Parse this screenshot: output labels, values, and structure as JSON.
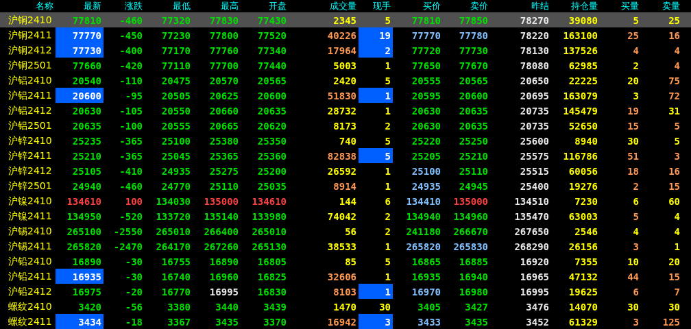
{
  "columns": [
    "名称",
    "最新",
    "涨跌",
    "最低",
    "最高",
    "开盘",
    "成交量",
    "现手",
    "买价",
    "卖价",
    "昨结",
    "持仓量",
    "买量",
    "卖量"
  ],
  "rows": [
    {
      "name": "沪铜2410",
      "selected": true,
      "cells": [
        {
          "text": "77810",
          "color": "#00e000",
          "highlighted": false
        },
        {
          "text": "-460",
          "color": "#00e000",
          "highlighted": false
        },
        {
          "text": "77320",
          "color": "#00e000",
          "highlighted": false
        },
        {
          "text": "77830",
          "color": "#00e000",
          "highlighted": false
        },
        {
          "text": "77430",
          "color": "#00e000",
          "highlighted": false
        },
        {
          "text": "2345",
          "color": "#ffff00",
          "highlighted": false
        },
        {
          "text": "5",
          "color": "#ffff00",
          "highlighted": false
        },
        {
          "text": "77810",
          "color": "#00e000",
          "highlighted": false
        },
        {
          "text": "77850",
          "color": "#00e000",
          "highlighted": false
        },
        {
          "text": "78270",
          "color": "#e8e8e8",
          "highlighted": false
        },
        {
          "text": "39080",
          "color": "#ffff00",
          "highlighted": false
        },
        {
          "text": "5",
          "color": "#ffff00",
          "highlighted": false
        },
        {
          "text": "25",
          "color": "#ffff00",
          "highlighted": false
        }
      ]
    },
    {
      "name": "沪铜2411",
      "selected": false,
      "cells": [
        {
          "text": "77770",
          "color": "#ffffff",
          "highlighted": true
        },
        {
          "text": "-450",
          "color": "#00e000",
          "highlighted": false
        },
        {
          "text": "77230",
          "color": "#00e000",
          "highlighted": false
        },
        {
          "text": "77800",
          "color": "#00e000",
          "highlighted": false
        },
        {
          "text": "77520",
          "color": "#00e000",
          "highlighted": false
        },
        {
          "text": "40226",
          "color": "#ff9850",
          "highlighted": false
        },
        {
          "text": "19",
          "color": "#ffffff",
          "highlighted": true
        },
        {
          "text": "77770",
          "color": "#80c0ff",
          "highlighted": false
        },
        {
          "text": "77780",
          "color": "#80c0ff",
          "highlighted": false
        },
        {
          "text": "78220",
          "color": "#e8e8e8",
          "highlighted": false
        },
        {
          "text": "163100",
          "color": "#ffff00",
          "highlighted": false
        },
        {
          "text": "25",
          "color": "#ff9850",
          "highlighted": false
        },
        {
          "text": "16",
          "color": "#ff9850",
          "highlighted": false
        }
      ]
    },
    {
      "name": "沪铜2412",
      "selected": false,
      "cells": [
        {
          "text": "77730",
          "color": "#ffffff",
          "highlighted": true
        },
        {
          "text": "-400",
          "color": "#00e000",
          "highlighted": false
        },
        {
          "text": "77170",
          "color": "#00e000",
          "highlighted": false
        },
        {
          "text": "77760",
          "color": "#00e000",
          "highlighted": false
        },
        {
          "text": "77340",
          "color": "#00e000",
          "highlighted": false
        },
        {
          "text": "17964",
          "color": "#ff9850",
          "highlighted": false
        },
        {
          "text": "2",
          "color": "#ffffff",
          "highlighted": true
        },
        {
          "text": "77720",
          "color": "#00e000",
          "highlighted": false
        },
        {
          "text": "77730",
          "color": "#00e000",
          "highlighted": false
        },
        {
          "text": "78130",
          "color": "#e8e8e8",
          "highlighted": false
        },
        {
          "text": "137526",
          "color": "#ffff00",
          "highlighted": false
        },
        {
          "text": "4",
          "color": "#ff9850",
          "highlighted": false
        },
        {
          "text": "4",
          "color": "#ff9850",
          "highlighted": false
        }
      ]
    },
    {
      "name": "沪铜2501",
      "selected": false,
      "cells": [
        {
          "text": "77660",
          "color": "#00e000",
          "highlighted": false
        },
        {
          "text": "-420",
          "color": "#00e000",
          "highlighted": false
        },
        {
          "text": "77110",
          "color": "#00e000",
          "highlighted": false
        },
        {
          "text": "77700",
          "color": "#00e000",
          "highlighted": false
        },
        {
          "text": "77440",
          "color": "#00e000",
          "highlighted": false
        },
        {
          "text": "5003",
          "color": "#ffff00",
          "highlighted": false
        },
        {
          "text": "1",
          "color": "#ffff00",
          "highlighted": false
        },
        {
          "text": "77650",
          "color": "#00e000",
          "highlighted": false
        },
        {
          "text": "77670",
          "color": "#00e000",
          "highlighted": false
        },
        {
          "text": "78080",
          "color": "#e8e8e8",
          "highlighted": false
        },
        {
          "text": "62985",
          "color": "#ffff00",
          "highlighted": false
        },
        {
          "text": "2",
          "color": "#ffff00",
          "highlighted": false
        },
        {
          "text": "4",
          "color": "#ff9850",
          "highlighted": false
        }
      ]
    },
    {
      "name": "沪铝2410",
      "selected": false,
      "cells": [
        {
          "text": "20540",
          "color": "#00e000",
          "highlighted": false
        },
        {
          "text": "-110",
          "color": "#00e000",
          "highlighted": false
        },
        {
          "text": "20475",
          "color": "#00e000",
          "highlighted": false
        },
        {
          "text": "20570",
          "color": "#00e000",
          "highlighted": false
        },
        {
          "text": "20565",
          "color": "#00e000",
          "highlighted": false
        },
        {
          "text": "2420",
          "color": "#ffff00",
          "highlighted": false
        },
        {
          "text": "5",
          "color": "#ffff00",
          "highlighted": false
        },
        {
          "text": "20555",
          "color": "#00e000",
          "highlighted": false
        },
        {
          "text": "20565",
          "color": "#00e000",
          "highlighted": false
        },
        {
          "text": "20650",
          "color": "#e8e8e8",
          "highlighted": false
        },
        {
          "text": "22225",
          "color": "#ffff00",
          "highlighted": false
        },
        {
          "text": "20",
          "color": "#ffff00",
          "highlighted": false
        },
        {
          "text": "75",
          "color": "#ff9850",
          "highlighted": false
        }
      ]
    },
    {
      "name": "沪铝2411",
      "selected": false,
      "cells": [
        {
          "text": "20600",
          "color": "#ffffff",
          "highlighted": true
        },
        {
          "text": "-95",
          "color": "#00e000",
          "highlighted": false
        },
        {
          "text": "20505",
          "color": "#00e000",
          "highlighted": false
        },
        {
          "text": "20625",
          "color": "#00e000",
          "highlighted": false
        },
        {
          "text": "20600",
          "color": "#00e000",
          "highlighted": false
        },
        {
          "text": "51830",
          "color": "#ff9850",
          "highlighted": false
        },
        {
          "text": "1",
          "color": "#ffffff",
          "highlighted": true
        },
        {
          "text": "20595",
          "color": "#00e000",
          "highlighted": false
        },
        {
          "text": "20600",
          "color": "#00e000",
          "highlighted": false
        },
        {
          "text": "20695",
          "color": "#e8e8e8",
          "highlighted": false
        },
        {
          "text": "163079",
          "color": "#ffff00",
          "highlighted": false
        },
        {
          "text": "3",
          "color": "#ffff00",
          "highlighted": false
        },
        {
          "text": "72",
          "color": "#ff9850",
          "highlighted": false
        }
      ]
    },
    {
      "name": "沪铝2412",
      "selected": false,
      "cells": [
        {
          "text": "20630",
          "color": "#00e000",
          "highlighted": false
        },
        {
          "text": "-105",
          "color": "#00e000",
          "highlighted": false
        },
        {
          "text": "20550",
          "color": "#00e000",
          "highlighted": false
        },
        {
          "text": "20660",
          "color": "#00e000",
          "highlighted": false
        },
        {
          "text": "20635",
          "color": "#00e000",
          "highlighted": false
        },
        {
          "text": "28732",
          "color": "#ffff00",
          "highlighted": false
        },
        {
          "text": "1",
          "color": "#ffff00",
          "highlighted": false
        },
        {
          "text": "20630",
          "color": "#00e000",
          "highlighted": false
        },
        {
          "text": "20635",
          "color": "#00e000",
          "highlighted": false
        },
        {
          "text": "20735",
          "color": "#e8e8e8",
          "highlighted": false
        },
        {
          "text": "145479",
          "color": "#ffff00",
          "highlighted": false
        },
        {
          "text": "19",
          "color": "#ff9850",
          "highlighted": false
        },
        {
          "text": "31",
          "color": "#ffff00",
          "highlighted": false
        }
      ]
    },
    {
      "name": "沪铝2501",
      "selected": false,
      "cells": [
        {
          "text": "20635",
          "color": "#00e000",
          "highlighted": false
        },
        {
          "text": "-100",
          "color": "#00e000",
          "highlighted": false
        },
        {
          "text": "20555",
          "color": "#00e000",
          "highlighted": false
        },
        {
          "text": "20665",
          "color": "#00e000",
          "highlighted": false
        },
        {
          "text": "20620",
          "color": "#00e000",
          "highlighted": false
        },
        {
          "text": "8173",
          "color": "#ffff00",
          "highlighted": false
        },
        {
          "text": "2",
          "color": "#ffff00",
          "highlighted": false
        },
        {
          "text": "20630",
          "color": "#00e000",
          "highlighted": false
        },
        {
          "text": "20635",
          "color": "#00e000",
          "highlighted": false
        },
        {
          "text": "20735",
          "color": "#e8e8e8",
          "highlighted": false
        },
        {
          "text": "52650",
          "color": "#ffff00",
          "highlighted": false
        },
        {
          "text": "15",
          "color": "#ff9850",
          "highlighted": false
        },
        {
          "text": "5",
          "color": "#ff9850",
          "highlighted": false
        }
      ]
    },
    {
      "name": "沪锌2410",
      "selected": false,
      "cells": [
        {
          "text": "25235",
          "color": "#00e000",
          "highlighted": false
        },
        {
          "text": "-365",
          "color": "#00e000",
          "highlighted": false
        },
        {
          "text": "25100",
          "color": "#00e000",
          "highlighted": false
        },
        {
          "text": "25380",
          "color": "#00e000",
          "highlighted": false
        },
        {
          "text": "25350",
          "color": "#00e000",
          "highlighted": false
        },
        {
          "text": "740",
          "color": "#ffff00",
          "highlighted": false
        },
        {
          "text": "5",
          "color": "#ffff00",
          "highlighted": false
        },
        {
          "text": "25220",
          "color": "#00e000",
          "highlighted": false
        },
        {
          "text": "25250",
          "color": "#00e000",
          "highlighted": false
        },
        {
          "text": "25600",
          "color": "#e8e8e8",
          "highlighted": false
        },
        {
          "text": "8940",
          "color": "#ffff00",
          "highlighted": false
        },
        {
          "text": "30",
          "color": "#ffff00",
          "highlighted": false
        },
        {
          "text": "5",
          "color": "#ffff00",
          "highlighted": false
        }
      ]
    },
    {
      "name": "沪锌2411",
      "selected": false,
      "cells": [
        {
          "text": "25210",
          "color": "#00e000",
          "highlighted": false
        },
        {
          "text": "-365",
          "color": "#00e000",
          "highlighted": false
        },
        {
          "text": "25045",
          "color": "#00e000",
          "highlighted": false
        },
        {
          "text": "25365",
          "color": "#00e000",
          "highlighted": false
        },
        {
          "text": "25360",
          "color": "#00e000",
          "highlighted": false
        },
        {
          "text": "82838",
          "color": "#ff9850",
          "highlighted": false
        },
        {
          "text": "5",
          "color": "#ffffff",
          "highlighted": true
        },
        {
          "text": "25205",
          "color": "#00e000",
          "highlighted": false
        },
        {
          "text": "25210",
          "color": "#00e000",
          "highlighted": false
        },
        {
          "text": "25575",
          "color": "#e8e8e8",
          "highlighted": false
        },
        {
          "text": "116786",
          "color": "#ffff00",
          "highlighted": false
        },
        {
          "text": "51",
          "color": "#ff9850",
          "highlighted": false
        },
        {
          "text": "3",
          "color": "#ff9850",
          "highlighted": false
        }
      ]
    },
    {
      "name": "沪锌2412",
      "selected": false,
      "cells": [
        {
          "text": "25105",
          "color": "#00e000",
          "highlighted": false
        },
        {
          "text": "-410",
          "color": "#00e000",
          "highlighted": false
        },
        {
          "text": "24935",
          "color": "#00e000",
          "highlighted": false
        },
        {
          "text": "25275",
          "color": "#00e000",
          "highlighted": false
        },
        {
          "text": "25200",
          "color": "#00e000",
          "highlighted": false
        },
        {
          "text": "26592",
          "color": "#ffff00",
          "highlighted": false
        },
        {
          "text": "1",
          "color": "#ffff00",
          "highlighted": false
        },
        {
          "text": "25100",
          "color": "#80c0ff",
          "highlighted": false
        },
        {
          "text": "25110",
          "color": "#00e000",
          "highlighted": false
        },
        {
          "text": "25515",
          "color": "#e8e8e8",
          "highlighted": false
        },
        {
          "text": "60056",
          "color": "#ffff00",
          "highlighted": false
        },
        {
          "text": "18",
          "color": "#ff9850",
          "highlighted": false
        },
        {
          "text": "16",
          "color": "#ff9850",
          "highlighted": false
        }
      ]
    },
    {
      "name": "沪锌2501",
      "selected": false,
      "cells": [
        {
          "text": "24940",
          "color": "#00e000",
          "highlighted": false
        },
        {
          "text": "-460",
          "color": "#00e000",
          "highlighted": false
        },
        {
          "text": "24770",
          "color": "#00e000",
          "highlighted": false
        },
        {
          "text": "25110",
          "color": "#00e000",
          "highlighted": false
        },
        {
          "text": "25035",
          "color": "#00e000",
          "highlighted": false
        },
        {
          "text": "8914",
          "color": "#ff9850",
          "highlighted": false
        },
        {
          "text": "1",
          "color": "#ffff00",
          "highlighted": false
        },
        {
          "text": "24935",
          "color": "#80c0ff",
          "highlighted": false
        },
        {
          "text": "24945",
          "color": "#00e000",
          "highlighted": false
        },
        {
          "text": "25400",
          "color": "#e8e8e8",
          "highlighted": false
        },
        {
          "text": "19276",
          "color": "#ffff00",
          "highlighted": false
        },
        {
          "text": "2",
          "color": "#ff9850",
          "highlighted": false
        },
        {
          "text": "15",
          "color": "#ff9850",
          "highlighted": false
        }
      ]
    },
    {
      "name": "沪镍2410",
      "selected": false,
      "cells": [
        {
          "text": "134610",
          "color": "#ff4040",
          "highlighted": false
        },
        {
          "text": "100",
          "color": "#ff4040",
          "highlighted": false
        },
        {
          "text": "134030",
          "color": "#00e000",
          "highlighted": false
        },
        {
          "text": "135000",
          "color": "#ff4040",
          "highlighted": false
        },
        {
          "text": "134610",
          "color": "#ff4040",
          "highlighted": false
        },
        {
          "text": "144",
          "color": "#ffff00",
          "highlighted": false
        },
        {
          "text": "6",
          "color": "#ffff00",
          "highlighted": false
        },
        {
          "text": "134410",
          "color": "#80c0ff",
          "highlighted": false
        },
        {
          "text": "135000",
          "color": "#ff4040",
          "highlighted": false
        },
        {
          "text": "134510",
          "color": "#e8e8e8",
          "highlighted": false
        },
        {
          "text": "7230",
          "color": "#ffff00",
          "highlighted": false
        },
        {
          "text": "6",
          "color": "#ffff00",
          "highlighted": false
        },
        {
          "text": "60",
          "color": "#ffff00",
          "highlighted": false
        }
      ]
    },
    {
      "name": "沪镍2411",
      "selected": false,
      "cells": [
        {
          "text": "134950",
          "color": "#00e000",
          "highlighted": false
        },
        {
          "text": "-520",
          "color": "#00e000",
          "highlighted": false
        },
        {
          "text": "133720",
          "color": "#00e000",
          "highlighted": false
        },
        {
          "text": "135140",
          "color": "#00e000",
          "highlighted": false
        },
        {
          "text": "133980",
          "color": "#00e000",
          "highlighted": false
        },
        {
          "text": "74042",
          "color": "#ffff00",
          "highlighted": false
        },
        {
          "text": "2",
          "color": "#ffff00",
          "highlighted": false
        },
        {
          "text": "134940",
          "color": "#00e000",
          "highlighted": false
        },
        {
          "text": "134960",
          "color": "#00e000",
          "highlighted": false
        },
        {
          "text": "135470",
          "color": "#e8e8e8",
          "highlighted": false
        },
        {
          "text": "63003",
          "color": "#ffff00",
          "highlighted": false
        },
        {
          "text": "5",
          "color": "#ff9850",
          "highlighted": false
        },
        {
          "text": "4",
          "color": "#ffff00",
          "highlighted": false
        }
      ]
    },
    {
      "name": "沪锡2410",
      "selected": false,
      "cells": [
        {
          "text": "265100",
          "color": "#00e000",
          "highlighted": false
        },
        {
          "text": "-2550",
          "color": "#00e000",
          "highlighted": false
        },
        {
          "text": "265010",
          "color": "#00e000",
          "highlighted": false
        },
        {
          "text": "266400",
          "color": "#00e000",
          "highlighted": false
        },
        {
          "text": "265010",
          "color": "#00e000",
          "highlighted": false
        },
        {
          "text": "56",
          "color": "#ffff00",
          "highlighted": false
        },
        {
          "text": "2",
          "color": "#ffff00",
          "highlighted": false
        },
        {
          "text": "241180",
          "color": "#00e000",
          "highlighted": false
        },
        {
          "text": "266670",
          "color": "#00e000",
          "highlighted": false
        },
        {
          "text": "267650",
          "color": "#e8e8e8",
          "highlighted": false
        },
        {
          "text": "2546",
          "color": "#ffff00",
          "highlighted": false
        },
        {
          "text": "4",
          "color": "#ffff00",
          "highlighted": false
        },
        {
          "text": "4",
          "color": "#ffff00",
          "highlighted": false
        }
      ]
    },
    {
      "name": "沪锡2411",
      "selected": false,
      "cells": [
        {
          "text": "265820",
          "color": "#00e000",
          "highlighted": false
        },
        {
          "text": "-2470",
          "color": "#00e000",
          "highlighted": false
        },
        {
          "text": "264170",
          "color": "#00e000",
          "highlighted": false
        },
        {
          "text": "267260",
          "color": "#00e000",
          "highlighted": false
        },
        {
          "text": "265130",
          "color": "#00e000",
          "highlighted": false
        },
        {
          "text": "38533",
          "color": "#ffff00",
          "highlighted": false
        },
        {
          "text": "1",
          "color": "#ffff00",
          "highlighted": false
        },
        {
          "text": "265820",
          "color": "#80c0ff",
          "highlighted": false
        },
        {
          "text": "265830",
          "color": "#80c0ff",
          "highlighted": false
        },
        {
          "text": "268290",
          "color": "#e8e8e8",
          "highlighted": false
        },
        {
          "text": "26156",
          "color": "#ffff00",
          "highlighted": false
        },
        {
          "text": "3",
          "color": "#ff9850",
          "highlighted": false
        },
        {
          "text": "1",
          "color": "#ffff00",
          "highlighted": false
        }
      ]
    },
    {
      "name": "沪铅2410",
      "selected": false,
      "cells": [
        {
          "text": "16890",
          "color": "#00e000",
          "highlighted": false
        },
        {
          "text": "-30",
          "color": "#00e000",
          "highlighted": false
        },
        {
          "text": "16755",
          "color": "#00e000",
          "highlighted": false
        },
        {
          "text": "16890",
          "color": "#00e000",
          "highlighted": false
        },
        {
          "text": "16805",
          "color": "#00e000",
          "highlighted": false
        },
        {
          "text": "85",
          "color": "#ffff00",
          "highlighted": false
        },
        {
          "text": "5",
          "color": "#ffff00",
          "highlighted": false
        },
        {
          "text": "16865",
          "color": "#00e000",
          "highlighted": false
        },
        {
          "text": "16885",
          "color": "#00e000",
          "highlighted": false
        },
        {
          "text": "16920",
          "color": "#e8e8e8",
          "highlighted": false
        },
        {
          "text": "7355",
          "color": "#ffff00",
          "highlighted": false
        },
        {
          "text": "10",
          "color": "#ffff00",
          "highlighted": false
        },
        {
          "text": "20",
          "color": "#ffff00",
          "highlighted": false
        }
      ]
    },
    {
      "name": "沪铅2411",
      "selected": false,
      "cells": [
        {
          "text": "16935",
          "color": "#ffffff",
          "highlighted": true
        },
        {
          "text": "-30",
          "color": "#00e000",
          "highlighted": false
        },
        {
          "text": "16740",
          "color": "#00e000",
          "highlighted": false
        },
        {
          "text": "16960",
          "color": "#00e000",
          "highlighted": false
        },
        {
          "text": "16825",
          "color": "#00e000",
          "highlighted": false
        },
        {
          "text": "32606",
          "color": "#ff9850",
          "highlighted": false
        },
        {
          "text": "1",
          "color": "#ffff00",
          "highlighted": false
        },
        {
          "text": "16935",
          "color": "#00e000",
          "highlighted": false
        },
        {
          "text": "16940",
          "color": "#00e000",
          "highlighted": false
        },
        {
          "text": "16965",
          "color": "#e8e8e8",
          "highlighted": false
        },
        {
          "text": "47132",
          "color": "#ffff00",
          "highlighted": false
        },
        {
          "text": "44",
          "color": "#ff9850",
          "highlighted": false
        },
        {
          "text": "15",
          "color": "#ff9850",
          "highlighted": false
        }
      ]
    },
    {
      "name": "沪铅2412",
      "selected": false,
      "cells": [
        {
          "text": "16975",
          "color": "#00e000",
          "highlighted": false
        },
        {
          "text": "-20",
          "color": "#00e000",
          "highlighted": false
        },
        {
          "text": "16770",
          "color": "#00e000",
          "highlighted": false
        },
        {
          "text": "16995",
          "color": "#e8e8e8",
          "highlighted": false
        },
        {
          "text": "16830",
          "color": "#00e000",
          "highlighted": false
        },
        {
          "text": "8103",
          "color": "#ff9850",
          "highlighted": false
        },
        {
          "text": "1",
          "color": "#ffffff",
          "highlighted": true
        },
        {
          "text": "16970",
          "color": "#80c0ff",
          "highlighted": false
        },
        {
          "text": "16980",
          "color": "#00e000",
          "highlighted": false
        },
        {
          "text": "16995",
          "color": "#e8e8e8",
          "highlighted": false
        },
        {
          "text": "19625",
          "color": "#ffff00",
          "highlighted": false
        },
        {
          "text": "6",
          "color": "#ff9850",
          "highlighted": false
        },
        {
          "text": "7",
          "color": "#ff9850",
          "highlighted": false
        }
      ]
    },
    {
      "name": "螺纹2410",
      "selected": false,
      "cells": [
        {
          "text": "3420",
          "color": "#00e000",
          "highlighted": false
        },
        {
          "text": "-56",
          "color": "#00e000",
          "highlighted": false
        },
        {
          "text": "3380",
          "color": "#00e000",
          "highlighted": false
        },
        {
          "text": "3440",
          "color": "#00e000",
          "highlighted": false
        },
        {
          "text": "3439",
          "color": "#00e000",
          "highlighted": false
        },
        {
          "text": "1470",
          "color": "#ffff00",
          "highlighted": false
        },
        {
          "text": "30",
          "color": "#ffff00",
          "highlighted": false
        },
        {
          "text": "3405",
          "color": "#00e000",
          "highlighted": false
        },
        {
          "text": "3427",
          "color": "#00e000",
          "highlighted": false
        },
        {
          "text": "3476",
          "color": "#e8e8e8",
          "highlighted": false
        },
        {
          "text": "14070",
          "color": "#ffff00",
          "highlighted": false
        },
        {
          "text": "30",
          "color": "#ffff00",
          "highlighted": false
        },
        {
          "text": "30",
          "color": "#ffff00",
          "highlighted": false
        }
      ]
    },
    {
      "name": "螺纹2411",
      "selected": false,
      "cells": [
        {
          "text": "3434",
          "color": "#ffffff",
          "highlighted": true
        },
        {
          "text": "-18",
          "color": "#00e000",
          "highlighted": false
        },
        {
          "text": "3367",
          "color": "#00e000",
          "highlighted": false
        },
        {
          "text": "3435",
          "color": "#00e000",
          "highlighted": false
        },
        {
          "text": "3370",
          "color": "#00e000",
          "highlighted": false
        },
        {
          "text": "16942",
          "color": "#ff9850",
          "highlighted": false
        },
        {
          "text": "3",
          "color": "#ffffff",
          "highlighted": true
        },
        {
          "text": "3433",
          "color": "#80c0ff",
          "highlighted": false
        },
        {
          "text": "3435",
          "color": "#00e000",
          "highlighted": false
        },
        {
          "text": "3452",
          "color": "#e8e8e8",
          "highlighted": false
        },
        {
          "text": "61329",
          "color": "#ffff00",
          "highlighted": false
        },
        {
          "text": "3",
          "color": "#ff9850",
          "highlighted": false
        },
        {
          "text": "125",
          "color": "#ff9850",
          "highlighted": false
        }
      ]
    }
  ]
}
